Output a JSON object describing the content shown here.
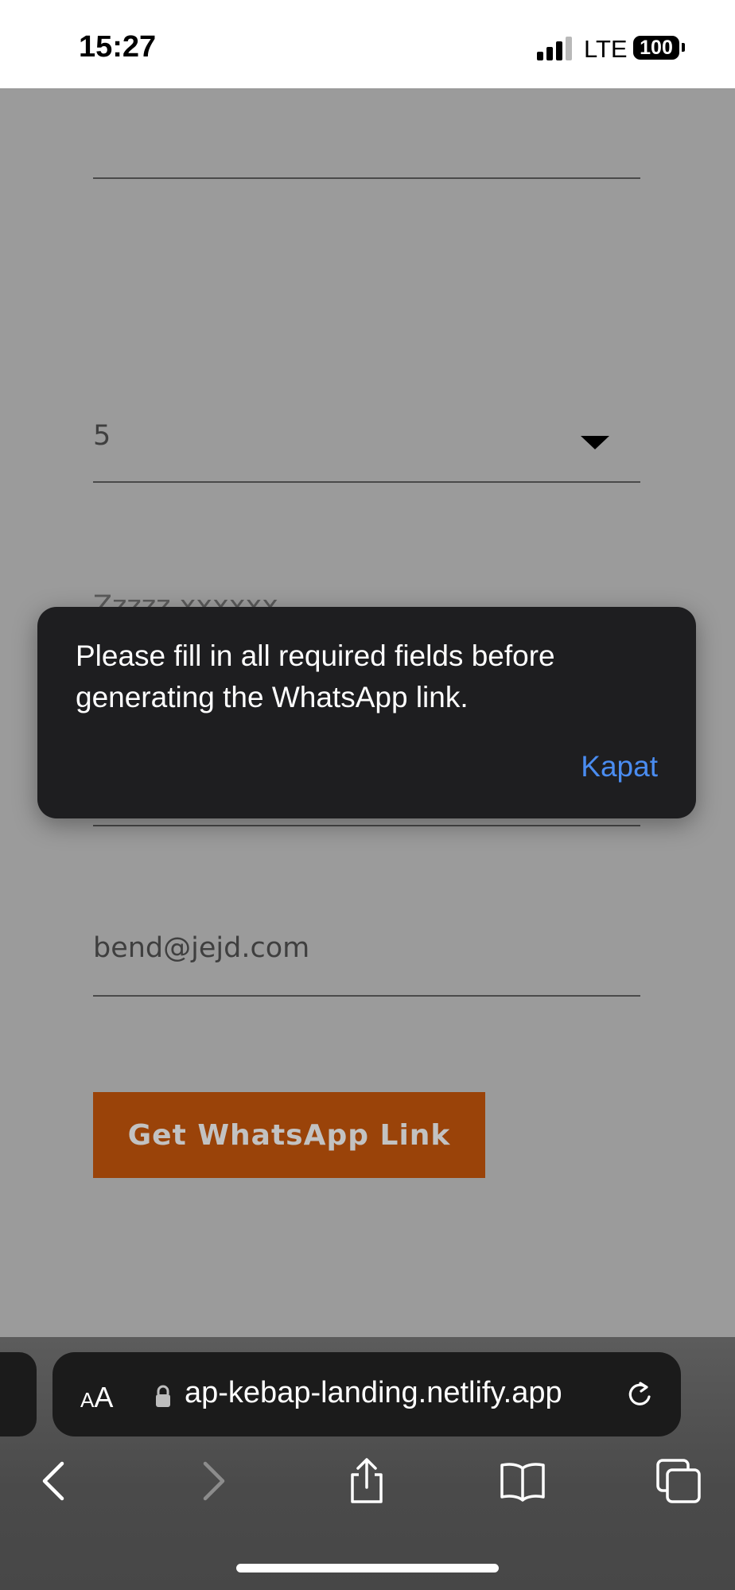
{
  "status_bar": {
    "time": "15:27",
    "network": "LTE",
    "battery": "100"
  },
  "form": {
    "party_size_value": "5",
    "obscured_field_text": "Zzzzz xxxxxx",
    "email_value": "bend@jejd.com",
    "submit_label": "Get WhatsApp Link",
    "submit_color": "#9a4309"
  },
  "alert": {
    "message": "Please fill in all required fields before generating the WhatsApp link.",
    "close_label": "Kapat",
    "close_color": "#4a8cf0"
  },
  "browser": {
    "text_size_label_small": "A",
    "text_size_label_big": "A",
    "url": "ap-kebap-landing.netlify.app",
    "icons": [
      "back-icon",
      "forward-icon",
      "share-icon",
      "bookmarks-icon",
      "tabs-icon",
      "lock-icon",
      "reload-icon"
    ]
  }
}
